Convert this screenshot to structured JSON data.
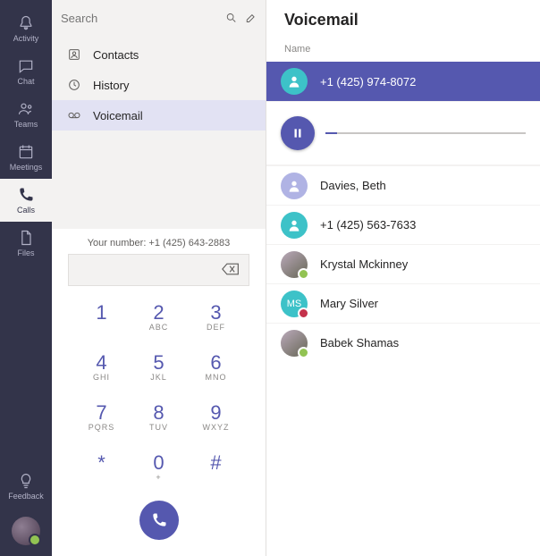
{
  "rail": {
    "items": [
      {
        "label": "Activity"
      },
      {
        "label": "Chat"
      },
      {
        "label": "Teams"
      },
      {
        "label": "Meetings"
      },
      {
        "label": "Calls"
      },
      {
        "label": "Files"
      }
    ],
    "feedback_label": "Feedback"
  },
  "search": {
    "placeholder": "Search"
  },
  "calls_nav": {
    "contacts": "Contacts",
    "history": "History",
    "voicemail": "Voicemail"
  },
  "dialer": {
    "your_number_label": "Your number: +1 (425) 643-2883",
    "keys": [
      {
        "d": "1",
        "l": ""
      },
      {
        "d": "2",
        "l": "ABC"
      },
      {
        "d": "3",
        "l": "DEF"
      },
      {
        "d": "4",
        "l": "GHI"
      },
      {
        "d": "5",
        "l": "JKL"
      },
      {
        "d": "6",
        "l": "MNO"
      },
      {
        "d": "7",
        "l": "PQRS"
      },
      {
        "d": "8",
        "l": "TUV"
      },
      {
        "d": "9",
        "l": "WXYZ"
      },
      {
        "d": "*",
        "l": ""
      },
      {
        "d": "0",
        "l": "+"
      },
      {
        "d": "#",
        "l": ""
      }
    ]
  },
  "voicemail": {
    "title": "Voicemail",
    "column": "Name",
    "entries": [
      {
        "name": "+1 (425) 974-8072",
        "avatar": "teal-icon",
        "presence": "none"
      },
      {
        "name": "Davies, Beth",
        "avatar": "lavender-icon",
        "presence": "none"
      },
      {
        "name": "+1 (425) 563-7633",
        "avatar": "teal-icon",
        "presence": "none"
      },
      {
        "name": "Krystal Mckinney",
        "avatar": "photo",
        "presence": "available"
      },
      {
        "name": "Mary Silver",
        "avatar": "initials",
        "presence": "dnd",
        "initials": "MS"
      },
      {
        "name": "Babek Shamas",
        "avatar": "photo",
        "presence": "available"
      }
    ]
  }
}
